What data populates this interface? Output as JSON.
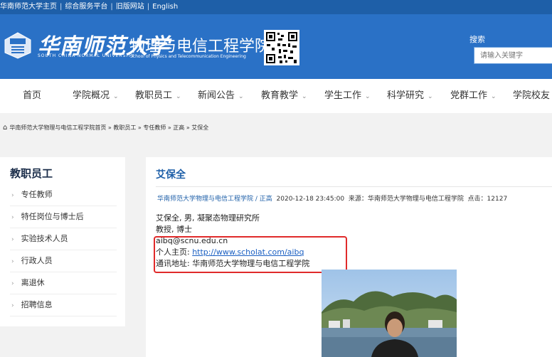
{
  "topbar": {
    "links": [
      "华南师范大学主页",
      "综合服务平台",
      "旧版网站",
      "English"
    ],
    "separator": "|"
  },
  "header": {
    "university_cn": "华南师范大学",
    "university_en": "SOUTH CHINA NORMAL UNIVERSITY",
    "school_cn": "物理与电信工程学院",
    "school_en": "School of Physics and Telecommunication Engineering"
  },
  "search": {
    "label": "搜索",
    "placeholder": "请输入关键字"
  },
  "nav": {
    "items": [
      {
        "label": "首页",
        "dropdown": false
      },
      {
        "label": "学院概况",
        "dropdown": true
      },
      {
        "label": "教职员工",
        "dropdown": true
      },
      {
        "label": "新闻公告",
        "dropdown": true
      },
      {
        "label": "教育教学",
        "dropdown": true
      },
      {
        "label": "学生工作",
        "dropdown": true
      },
      {
        "label": "科学研究",
        "dropdown": true
      },
      {
        "label": "党群工作",
        "dropdown": true
      },
      {
        "label": "学院校友",
        "dropdown": true
      }
    ],
    "chevron": "⌄"
  },
  "breadcrumb": {
    "text": "华南师范大学物理与电信工程学院首页 » 教职员工 » 专任教师 » 正高 » 艾保全"
  },
  "sidebar": {
    "title": "教职员工",
    "items": [
      "专任教师",
      "特任岗位与博士后",
      "实验技术人员",
      "行政人员",
      "离退休",
      "招聘信息"
    ]
  },
  "article": {
    "title": "艾保全",
    "meta_source_link": "华南师范大学物理与电信工程学院",
    "meta_sep": " / ",
    "meta_category": "正高",
    "meta_rest": "  2020-12-18 23:45:00  来源：华南师范大学物理与电信工程学院  点击：12127",
    "line1": "艾保全, 男, 凝聚态物理研究所",
    "line2": "教授, 博士",
    "email": "aibq@scnu.edu.cn",
    "homepage_label": "个人主页: ",
    "homepage_url": "http://www.scholat.com/aibq",
    "address": "通讯地址: 华南师范大学物理与电信工程学院"
  },
  "colors": {
    "header_blue": "#2a71c6",
    "topbar_blue": "#1e5fa8",
    "highlight_red": "#e02a2a"
  }
}
